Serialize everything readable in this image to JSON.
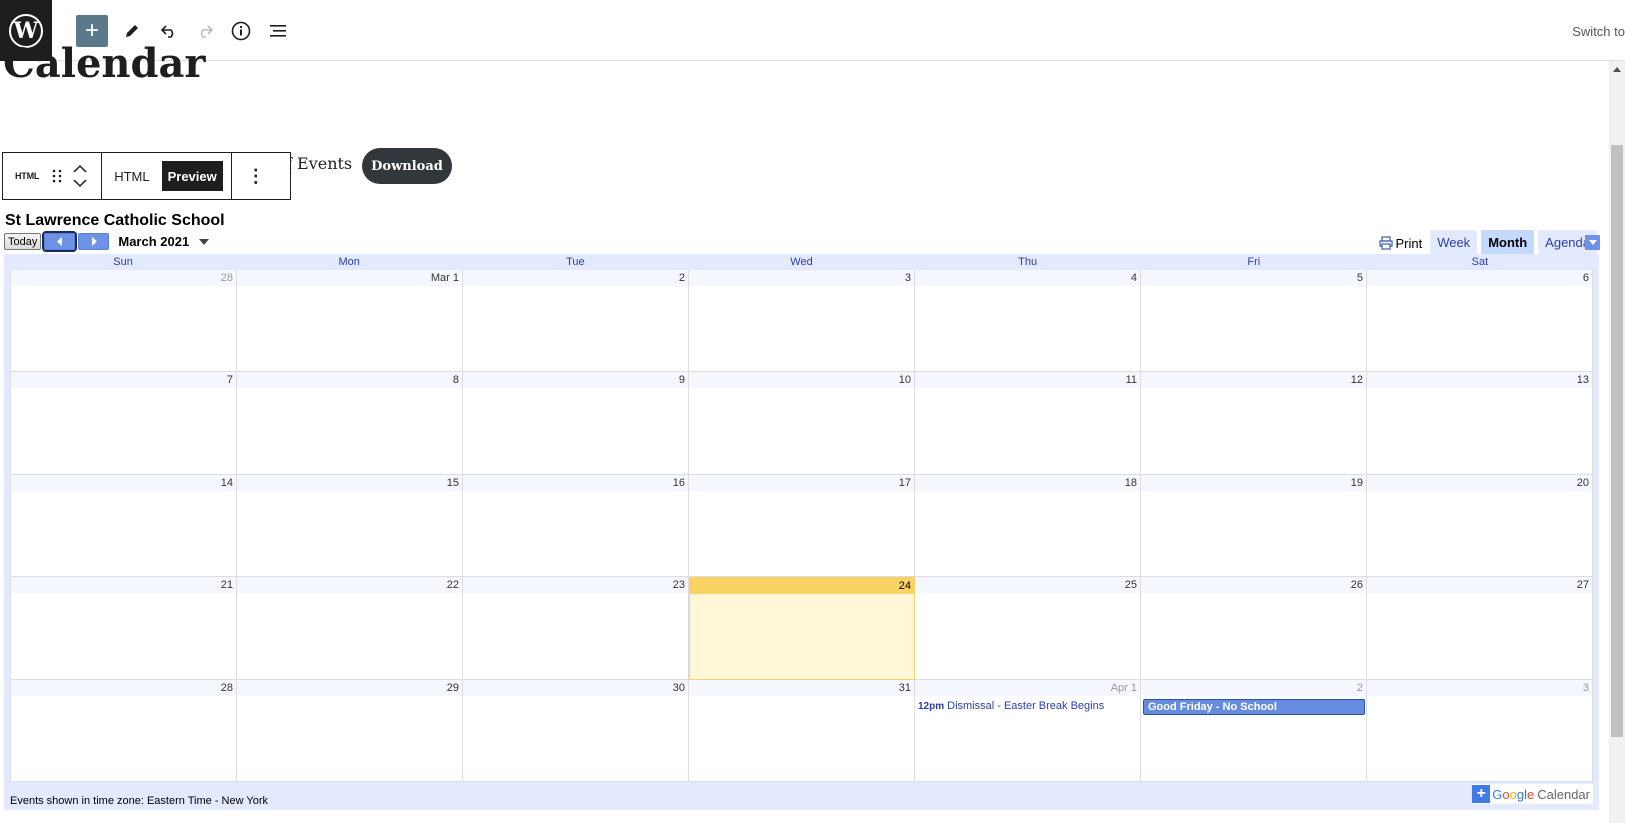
{
  "toolbar": {
    "add_icon": "plus-icon",
    "switch_label": "Switch to"
  },
  "editor": {
    "page_title": "Calendar",
    "partial_text": "f Events",
    "download_label": "Download"
  },
  "block_toolbar": {
    "block_type": "HTML",
    "tab_html": "HTML",
    "tab_preview": "Preview",
    "more": "⋮"
  },
  "calendar": {
    "title": "St Lawrence Catholic School",
    "today_label": "Today",
    "month_label": "March 2021",
    "print_label": "Print",
    "views": [
      "Week",
      "Month",
      "Agenda"
    ],
    "active_view": "Month",
    "weekdays": [
      "Sun",
      "Mon",
      "Tue",
      "Wed",
      "Thu",
      "Fri",
      "Sat"
    ],
    "weeks": [
      [
        {
          "d": "28",
          "other": true
        },
        {
          "d": "Mar 1"
        },
        {
          "d": "2"
        },
        {
          "d": "3"
        },
        {
          "d": "4"
        },
        {
          "d": "5"
        },
        {
          "d": "6"
        }
      ],
      [
        {
          "d": "7"
        },
        {
          "d": "8"
        },
        {
          "d": "9"
        },
        {
          "d": "10"
        },
        {
          "d": "11"
        },
        {
          "d": "12"
        },
        {
          "d": "13"
        }
      ],
      [
        {
          "d": "14"
        },
        {
          "d": "15"
        },
        {
          "d": "16"
        },
        {
          "d": "17"
        },
        {
          "d": "18"
        },
        {
          "d": "19"
        },
        {
          "d": "20"
        }
      ],
      [
        {
          "d": "21"
        },
        {
          "d": "22"
        },
        {
          "d": "23"
        },
        {
          "d": "24",
          "today": true
        },
        {
          "d": "25"
        },
        {
          "d": "26"
        },
        {
          "d": "27"
        }
      ],
      [
        {
          "d": "28"
        },
        {
          "d": "29"
        },
        {
          "d": "30"
        },
        {
          "d": "31"
        },
        {
          "d": "Apr 1",
          "other": true,
          "event": {
            "time": "12pm",
            "title": "Dismissal - Easter Break Begins"
          }
        },
        {
          "d": "2",
          "other": true,
          "allday": "Good Friday - No School"
        },
        {
          "d": "3",
          "other": true
        }
      ]
    ],
    "timezone_note": "Events shown in time zone: Eastern Time - New York",
    "brand": {
      "google": [
        "G",
        "o",
        "o",
        "g",
        "l",
        "e"
      ],
      "suffix": "Calendar"
    },
    "colors": {
      "today_bg": "#fff7d7",
      "today_header": "#fad163",
      "accent": "#668ce0",
      "frame": "#e3e9ff"
    }
  }
}
